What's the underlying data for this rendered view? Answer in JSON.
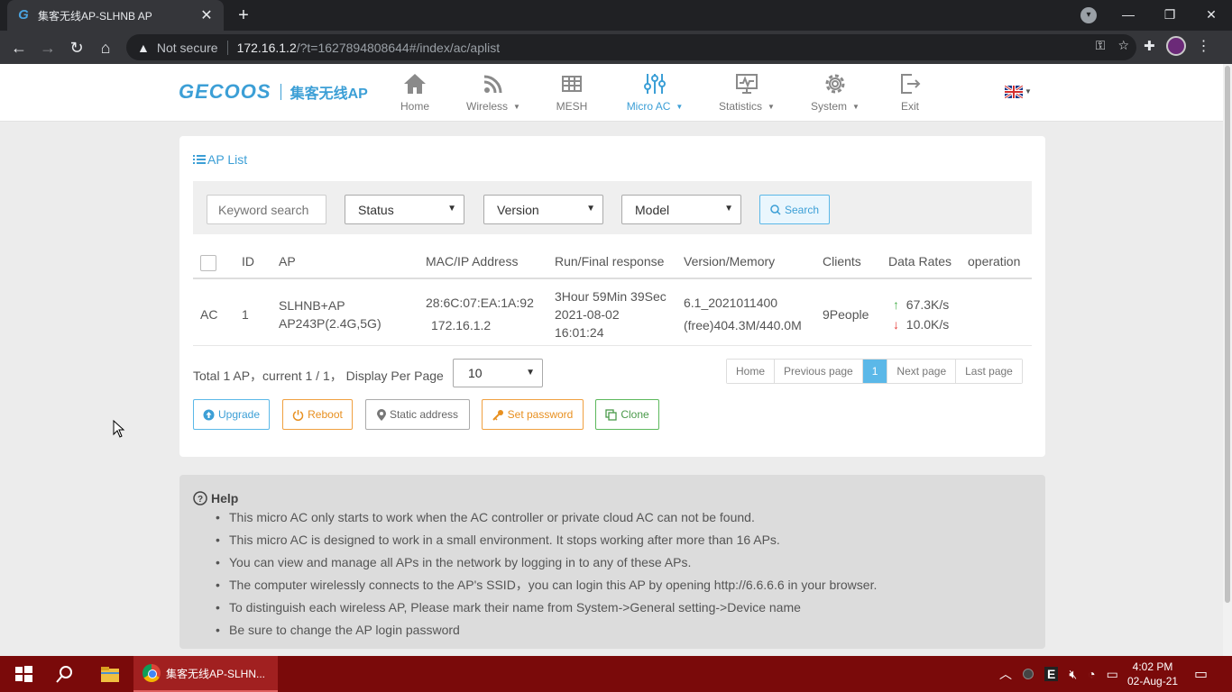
{
  "browser": {
    "tab_title": "集客无线AP-SLHNB AP",
    "tab_favicon": "G",
    "not_secure": "Not secure",
    "url_host": "172.16.1.2",
    "url_rest": "/?t=1627894808644#/index/ac/aplist"
  },
  "brand": {
    "logo_en": "GECOOS",
    "logo_cn": "集客无线AP"
  },
  "nav": {
    "items": [
      {
        "label": "Home",
        "icon": "home-icon"
      },
      {
        "label": "Wireless",
        "icon": "wifi-icon",
        "dropdown": true
      },
      {
        "label": "MESH",
        "icon": "mesh-icon"
      },
      {
        "label": "Micro AC",
        "icon": "sliders-icon",
        "dropdown": true,
        "active": true
      },
      {
        "label": "Statistics",
        "icon": "monitor-icon",
        "dropdown": true
      },
      {
        "label": "System",
        "icon": "gear-icon",
        "dropdown": true
      },
      {
        "label": "Exit",
        "icon": "exit-icon"
      }
    ]
  },
  "aplist": {
    "title": "AP List",
    "keyword_placeholder": "Keyword search",
    "status_select": "Status",
    "version_select": "Version",
    "model_select": "Model",
    "search_label": "Search",
    "columns": [
      "ID",
      "AP",
      "MAC/IP Address",
      "Run/Final response",
      "Version/Memory",
      "Clients",
      "Data Rates",
      "operation"
    ],
    "rows": [
      {
        "type": "AC",
        "id": "1",
        "ap_line1": "SLHNB+AP",
        "ap_line2": "AP243P(2.4G,5G)",
        "mac": "28:6C:07:EA:1A:92",
        "ip": "172.16.1.2",
        "run_line1": "3Hour 59Min 39Sec",
        "run_line2": "2021-08-02",
        "run_line3": "16:01:24",
        "version": "6.1_2021011400",
        "memory": "(free)404.3M/440.0M",
        "clients": "9People",
        "rate_up": "67.3K/s",
        "rate_down": "10.0K/s"
      }
    ],
    "total_info": "Total 1 AP，current 1 / 1， Display Per Page",
    "per_page": "10",
    "pagination": [
      "Home",
      "Previous page",
      "1",
      "Next page",
      "Last page"
    ],
    "actions": {
      "upgrade": "Upgrade",
      "reboot": "Reboot",
      "static_address": "Static address",
      "set_password": "Set password",
      "clone": "Clone"
    }
  },
  "help": {
    "title": "Help",
    "items": [
      "This micro AC only starts to work when the AC controller or private cloud AC can not be found.",
      "This micro AC is designed to work in a small environment. It stops working after more than 16 APs.",
      "You can view and manage all APs in the network by logging in to any of these APs.",
      "The computer wirelessly connects to the AP's SSID，you can login this AP by opening http://6.6.6.6 in your browser.",
      "To distinguish each wireless AP, Please mark their name from System->General setting->Device name",
      "Be sure to change the AP login password"
    ]
  },
  "taskbar": {
    "chrome_title": "集客无线AP-SLHN...",
    "time": "4:02 PM",
    "date": "02-Aug-21",
    "tray_e": "E"
  },
  "colors": {
    "accent": "#3c9fd6",
    "taskbar": "#7a0a0a"
  }
}
